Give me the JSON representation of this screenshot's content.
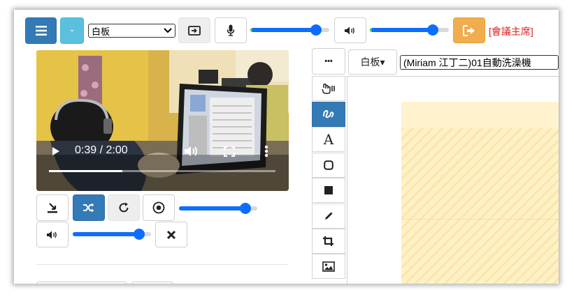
{
  "toolbar": {
    "minus_label": "-",
    "board_select_value": "白板",
    "leave_meeting_label": "[會議主席]",
    "colors": {
      "primary": "#337ab7",
      "info": "#5bc0de",
      "warning": "#f0ad4e",
      "danger_text": "#e02020",
      "slider": "#0d6efd"
    },
    "mic_level": 0.83,
    "speaker_level": 0.8
  },
  "video_player": {
    "time_display": "0:39 / 2:00",
    "progress": 0.325
  },
  "media_controls": {
    "playback_level": 0.85,
    "volume_level": 0.85
  },
  "whiteboard": {
    "more_label": "•••",
    "board_dropdown_label": "白板▾",
    "file_select_value": "(Miriam 江丁二)01自動洗澡機"
  },
  "tools": [
    "pointer-icon",
    "draw-icon",
    "text-icon",
    "rounded-rect-icon",
    "filled-rect-icon",
    "pencil-icon",
    "crop-icon",
    "image-icon"
  ],
  "tool_text_glyph": "A"
}
